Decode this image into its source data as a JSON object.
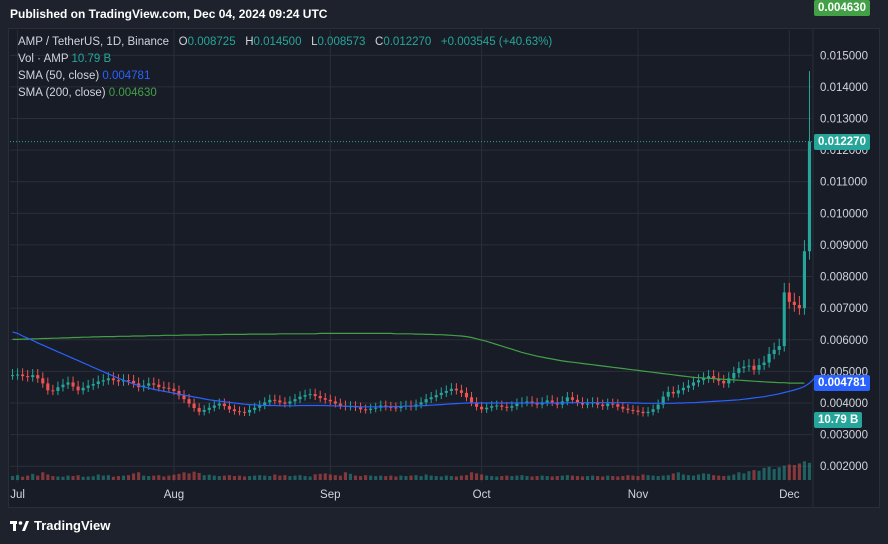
{
  "header": {
    "published": "Published on TradingView.com, Dec 04, 2024 09:24 UTC"
  },
  "legend": {
    "symbol": "AMP / TetherUS, 1D, Binance",
    "o_label": "O",
    "o_value": "0.008725",
    "h_label": "H",
    "h_value": "0.014500",
    "l_label": "L",
    "l_value": "0.008573",
    "c_label": "C",
    "c_value": "0.012270",
    "change": "+0.003545 (+40.63%)",
    "vol_label": "Vol · AMP",
    "vol_value": "10.79 B",
    "sma50_label": "SMA (50, close)",
    "sma50_value": "0.004781",
    "sma200_label": "SMA (200, close)",
    "sma200_value": "0.004630"
  },
  "badges": {
    "last_price": "0.012270",
    "sma50": "0.004781",
    "sma200": "0.004630",
    "volume": "10.79 B"
  },
  "colors": {
    "up": "#26a69a",
    "down": "#ef5350",
    "sma50": "#2962ff",
    "sma200": "#43a047",
    "grid": "#2a2e39",
    "axis_text": "#d1d4dc"
  },
  "footer": {
    "brand": "TradingView"
  },
  "chart_data": {
    "type": "candlestick",
    "title": "AMP / TetherUS, 1D, Binance",
    "y_ticks": [
      "0.015000",
      "0.014000",
      "0.013000",
      "0.012000",
      "0.011000",
      "0.010000",
      "0.009000",
      "0.008000",
      "0.007000",
      "0.006000",
      "0.005000",
      "0.004000",
      "0.003000",
      "0.002000"
    ],
    "y_tick_values": [
      0.015,
      0.014,
      0.013,
      0.012,
      0.011,
      0.01,
      0.009,
      0.008,
      0.007,
      0.006,
      0.005,
      0.004,
      0.003,
      0.002
    ],
    "x_ticks": [
      "Jul",
      "Aug",
      "Sep",
      "Oct",
      "Nov",
      "Dec"
    ],
    "x_tick_days": [
      1,
      32,
      63,
      93,
      124,
      154
    ],
    "ylim": [
      0.0015,
      0.0158
    ],
    "xlim": [
      -0.5,
      158.5
    ],
    "last_close": 0.01227,
    "close": [
      0.00488,
      0.0049,
      0.00485,
      0.00482,
      0.00488,
      0.00478,
      0.00462,
      0.0044,
      0.00438,
      0.0045,
      0.00458,
      0.00465,
      0.00452,
      0.0044,
      0.00448,
      0.00455,
      0.0046,
      0.00468,
      0.00472,
      0.00478,
      0.00472,
      0.00468,
      0.00472,
      0.0047,
      0.00462,
      0.0045,
      0.00455,
      0.00462,
      0.00458,
      0.0045,
      0.00448,
      0.00445,
      0.00438,
      0.00424,
      0.00412,
      0.00398,
      0.00384,
      0.00372,
      0.00378,
      0.00385,
      0.00392,
      0.00398,
      0.0039,
      0.0038,
      0.00374,
      0.00372,
      0.0037,
      0.00378,
      0.00385,
      0.00392,
      0.00402,
      0.0041,
      0.00408,
      0.00402,
      0.00398,
      0.00405,
      0.00412,
      0.0042,
      0.00425,
      0.00428,
      0.00422,
      0.00415,
      0.0041,
      0.00405,
      0.00398,
      0.00392,
      0.00388,
      0.0039,
      0.00386,
      0.0038,
      0.00378,
      0.00382,
      0.00385,
      0.00392,
      0.00388,
      0.00386,
      0.00384,
      0.0039,
      0.00392,
      0.00388,
      0.00395,
      0.00402,
      0.00412,
      0.00418,
      0.00425,
      0.00432,
      0.00438,
      0.00445,
      0.0044,
      0.00432,
      0.00418,
      0.00402,
      0.00388,
      0.0038,
      0.00385,
      0.0039,
      0.00392,
      0.00388,
      0.00385,
      0.0039,
      0.00398,
      0.00402,
      0.00405,
      0.004,
      0.00395,
      0.00402,
      0.00408,
      0.00402,
      0.00395,
      0.00405,
      0.00418,
      0.0041,
      0.00402,
      0.00395,
      0.00398,
      0.00402,
      0.00395,
      0.0039,
      0.00398,
      0.00396,
      0.00388,
      0.00382,
      0.00378,
      0.00376,
      0.00372,
      0.00368,
      0.00372,
      0.0038,
      0.00395,
      0.0042,
      0.00435,
      0.0043,
      0.0044,
      0.00448,
      0.00455,
      0.00465,
      0.00472,
      0.00478,
      0.00485,
      0.00478,
      0.0047,
      0.00462,
      0.00478,
      0.00495,
      0.0051,
      0.00515,
      0.00518,
      0.00505,
      0.0052,
      0.00528,
      0.00555,
      0.00568,
      0.0058,
      0.0075,
      0.0072,
      0.0071,
      0.007,
      0.0088,
      0.01227
    ],
    "sma50": [
      0.00625,
      0.0062,
      0.00612,
      0.00605,
      0.00598,
      0.0059,
      0.00583,
      0.00576,
      0.00569,
      0.00562,
      0.00555,
      0.00548,
      0.00541,
      0.00534,
      0.00527,
      0.0052,
      0.00513,
      0.00506,
      0.00499,
      0.00492,
      0.00485,
      0.00478,
      0.00472,
      0.00466,
      0.0046,
      0.00455,
      0.00451,
      0.00447,
      0.00443,
      0.0044,
      0.00437,
      0.00434,
      0.00431,
      0.00428,
      0.00425,
      0.00422,
      0.00419,
      0.00416,
      0.00413,
      0.0041,
      0.00408,
      0.00406,
      0.00404,
      0.00402,
      0.004,
      0.00398,
      0.00396,
      0.00395,
      0.00394,
      0.00393,
      0.00392,
      0.00392,
      0.00392,
      0.00391,
      0.00391,
      0.00391,
      0.00391,
      0.00392,
      0.00392,
      0.00392,
      0.00392,
      0.00392,
      0.00392,
      0.00391,
      0.00391,
      0.0039,
      0.0039,
      0.00389,
      0.00389,
      0.00388,
      0.00388,
      0.00388,
      0.00388,
      0.00388,
      0.00388,
      0.00389,
      0.00389,
      0.00389,
      0.0039,
      0.0039,
      0.00391,
      0.00391,
      0.00392,
      0.00393,
      0.00394,
      0.00395,
      0.00396,
      0.00397,
      0.00398,
      0.00399,
      0.004,
      0.004,
      0.004,
      0.004,
      0.004,
      0.004,
      0.004,
      0.004,
      0.004,
      0.004,
      0.004,
      0.004,
      0.004,
      0.004,
      0.004,
      0.004,
      0.004,
      0.004,
      0.004,
      0.004,
      0.00401,
      0.00401,
      0.00401,
      0.00401,
      0.00401,
      0.00401,
      0.00401,
      0.00401,
      0.00401,
      0.00401,
      0.00401,
      0.00401,
      0.00401,
      0.004,
      0.004,
      0.00399,
      0.00399,
      0.00399,
      0.00399,
      0.00399,
      0.00399,
      0.00399,
      0.004,
      0.004,
      0.00401,
      0.00401,
      0.00402,
      0.00403,
      0.00404,
      0.00405,
      0.00406,
      0.00407,
      0.00408,
      0.00409,
      0.0041,
      0.00412,
      0.00414,
      0.00416,
      0.00418,
      0.0042,
      0.00423,
      0.00426,
      0.00429,
      0.00433,
      0.00437,
      0.00441,
      0.00446,
      0.00452,
      0.00463,
      0.00478
    ],
    "sma200": [
      0.00601,
      0.00601,
      0.00602,
      0.00602,
      0.00603,
      0.00603,
      0.00604,
      0.00604,
      0.00605,
      0.00605,
      0.00606,
      0.00606,
      0.00607,
      0.00607,
      0.00608,
      0.00608,
      0.00609,
      0.00609,
      0.0061,
      0.0061,
      0.0061,
      0.00611,
      0.00611,
      0.00611,
      0.00612,
      0.00612,
      0.00612,
      0.00613,
      0.00613,
      0.00613,
      0.00614,
      0.00614,
      0.00614,
      0.00614,
      0.00615,
      0.00615,
      0.00615,
      0.00615,
      0.00616,
      0.00616,
      0.00616,
      0.00616,
      0.00617,
      0.00617,
      0.00617,
      0.00617,
      0.00617,
      0.00618,
      0.00618,
      0.00618,
      0.00618,
      0.00618,
      0.00618,
      0.00619,
      0.00619,
      0.00619,
      0.00619,
      0.00619,
      0.00619,
      0.00619,
      0.00619,
      0.0062,
      0.0062,
      0.0062,
      0.0062,
      0.0062,
      0.0062,
      0.0062,
      0.0062,
      0.0062,
      0.0062,
      0.0062,
      0.0062,
      0.0062,
      0.0062,
      0.0062,
      0.00619,
      0.00619,
      0.00619,
      0.00619,
      0.00618,
      0.00618,
      0.00617,
      0.00617,
      0.00616,
      0.00616,
      0.00615,
      0.00614,
      0.00613,
      0.00612,
      0.0061,
      0.00607,
      0.00603,
      0.00599,
      0.00595,
      0.0059,
      0.00585,
      0.0058,
      0.00575,
      0.0057,
      0.00565,
      0.0056,
      0.00556,
      0.00552,
      0.00548,
      0.00545,
      0.00542,
      0.00539,
      0.00536,
      0.00533,
      0.00531,
      0.00529,
      0.00527,
      0.00525,
      0.00523,
      0.00521,
      0.00519,
      0.00517,
      0.00515,
      0.00513,
      0.00511,
      0.00509,
      0.00507,
      0.00505,
      0.00503,
      0.00501,
      0.00499,
      0.00497,
      0.00495,
      0.00493,
      0.00491,
      0.00489,
      0.00487,
      0.00485,
      0.00483,
      0.00481,
      0.0048,
      0.00479,
      0.00478,
      0.00477,
      0.00476,
      0.00475,
      0.00474,
      0.00473,
      0.00472,
      0.00471,
      0.0047,
      0.00469,
      0.00468,
      0.00467,
      0.00466,
      0.00465,
      0.00464,
      0.00464,
      0.00463,
      0.00463,
      0.00463,
      0.00463
    ],
    "volume_rel": [
      0.18,
      0.22,
      0.15,
      0.2,
      0.28,
      0.2,
      0.35,
      0.25,
      0.18,
      0.16,
      0.15,
      0.2,
      0.18,
      0.22,
      0.15,
      0.16,
      0.17,
      0.25,
      0.2,
      0.22,
      0.15,
      0.18,
      0.2,
      0.22,
      0.3,
      0.35,
      0.2,
      0.18,
      0.2,
      0.22,
      0.16,
      0.2,
      0.24,
      0.28,
      0.35,
      0.3,
      0.38,
      0.32,
      0.22,
      0.24,
      0.2,
      0.18,
      0.2,
      0.22,
      0.18,
      0.2,
      0.16,
      0.18,
      0.2,
      0.22,
      0.2,
      0.18,
      0.25,
      0.2,
      0.22,
      0.18,
      0.2,
      0.22,
      0.18,
      0.16,
      0.26,
      0.28,
      0.3,
      0.25,
      0.22,
      0.2,
      0.35,
      0.28,
      0.2,
      0.18,
      0.22,
      0.2,
      0.18,
      0.2,
      0.18,
      0.2,
      0.16,
      0.2,
      0.18,
      0.2,
      0.22,
      0.18,
      0.25,
      0.2,
      0.18,
      0.16,
      0.2,
      0.18,
      0.16,
      0.2,
      0.22,
      0.35,
      0.3,
      0.25,
      0.2,
      0.18,
      0.16,
      0.18,
      0.2,
      0.18,
      0.2,
      0.22,
      0.18,
      0.16,
      0.18,
      0.2,
      0.18,
      0.16,
      0.18,
      0.2,
      0.22,
      0.2,
      0.18,
      0.16,
      0.18,
      0.2,
      0.18,
      0.16,
      0.2,
      0.18,
      0.16,
      0.18,
      0.22,
      0.2,
      0.18,
      0.25,
      0.22,
      0.2,
      0.18,
      0.2,
      0.22,
      0.3,
      0.35,
      0.25,
      0.22,
      0.2,
      0.25,
      0.3,
      0.28,
      0.22,
      0.2,
      0.18,
      0.2,
      0.25,
      0.35,
      0.3,
      0.4,
      0.45,
      0.42,
      0.55,
      0.6,
      0.5,
      0.58,
      0.65,
      0.7,
      0.68,
      0.75,
      0.85,
      0.78,
      1.0,
      1.25,
      1.35,
      1.55,
      1.85,
      2.05,
      3.05
    ]
  }
}
